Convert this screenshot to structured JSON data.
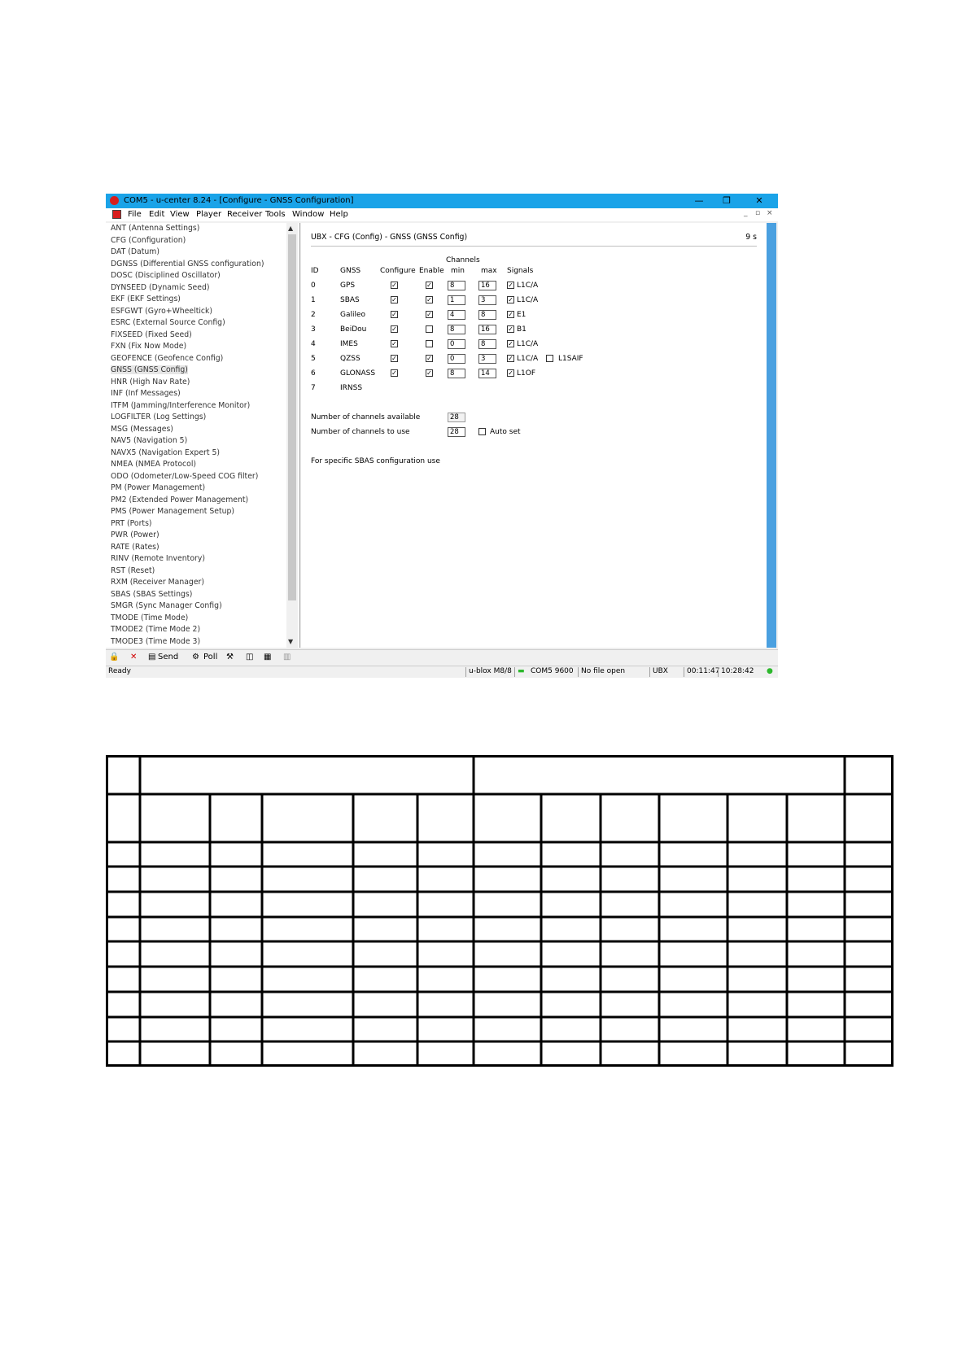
{
  "window": {
    "title": "COM5 - u-center 8.24 - [Configure - GNSS Configuration]",
    "controls": [
      "—",
      "❐",
      "✕"
    ],
    "mdi_controls": [
      "_",
      "▫",
      "×"
    ]
  },
  "menu": [
    "File",
    "Edit",
    "View",
    "Player",
    "Receiver",
    "Tools",
    "Window",
    "Help"
  ],
  "sidebar": {
    "items": [
      "ANT (Antenna Settings)",
      "CFG (Configuration)",
      "DAT (Datum)",
      "DGNSS (Differential GNSS configuration)",
      "DOSC (Disciplined Oscillator)",
      "DYNSEED (Dynamic Seed)",
      "EKF (EKF Settings)",
      "ESFGWT (Gyro+Wheeltick)",
      "ESRC (External Source Config)",
      "FIXSEED (Fixed Seed)",
      "FXN (Fix Now Mode)",
      "GEOFENCE (Geofence Config)",
      "GNSS (GNSS Config)",
      "HNR (High Nav Rate)",
      "INF (Inf Messages)",
      "ITFM (Jamming/Interference Monitor)",
      "LOGFILTER (Log Settings)",
      "MSG (Messages)",
      "NAV5 (Navigation 5)",
      "NAVX5 (Navigation Expert 5)",
      "NMEA (NMEA Protocol)",
      "ODO (Odometer/Low-Speed COG filter)",
      "PM (Power Management)",
      "PM2 (Extended Power Management)",
      "PMS (Power Management Setup)",
      "PRT (Ports)",
      "PWR (Power)",
      "RATE (Rates)",
      "RINV (Remote Inventory)",
      "RST (Reset)",
      "RXM (Receiver Manager)",
      "SBAS (SBAS Settings)",
      "SMGR (Sync Manager Config)",
      "TMODE (Time Mode)",
      "TMODE2 (Time Mode 2)",
      "TMODE3 (Time Mode 3)"
    ],
    "selected": "GNSS (GNSS Config)"
  },
  "panel": {
    "header": "UBX - CFG (Config) - GNSS (GNSS Config)",
    "timer": "9 s",
    "columns": {
      "id": "ID",
      "gnss": "GNSS",
      "configure": "Configure",
      "enable": "Enable",
      "channels": "Channels",
      "min": "min",
      "max": "max",
      "signals": "Signals"
    },
    "rows": [
      {
        "id": "0",
        "gnss": "GPS",
        "configure": true,
        "enable": true,
        "min": "8",
        "max": "16",
        "signal": "L1C/A"
      },
      {
        "id": "1",
        "gnss": "SBAS",
        "configure": true,
        "enable": true,
        "min": "1",
        "max": "3",
        "signal": "L1C/A"
      },
      {
        "id": "2",
        "gnss": "Galileo",
        "configure": true,
        "enable": true,
        "min": "4",
        "max": "8",
        "signal": "E1"
      },
      {
        "id": "3",
        "gnss": "BeiDou",
        "configure": true,
        "enable": false,
        "min": "8",
        "max": "16",
        "signal": "B1"
      },
      {
        "id": "4",
        "gnss": "IMES",
        "configure": true,
        "enable": false,
        "min": "0",
        "max": "8",
        "signal": "L1C/A"
      },
      {
        "id": "5",
        "gnss": "QZSS",
        "configure": true,
        "enable": true,
        "min": "0",
        "max": "3",
        "signal": "L1C/A",
        "extra_signal": "L1SAIF"
      },
      {
        "id": "6",
        "gnss": "GLONASS",
        "configure": true,
        "enable": true,
        "min": "8",
        "max": "14",
        "signal": "L1OF"
      },
      {
        "id": "7",
        "gnss": "IRNSS"
      }
    ],
    "channels_available_label": "Number of channels available",
    "channels_available": "28",
    "channels_to_use_label": "Number of channels to use",
    "channels_to_use": "28",
    "auto_set_label": "Auto set",
    "sbas_note": "For specific SBAS configuration use"
  },
  "toolbar": {
    "send": "Send",
    "poll": "Poll"
  },
  "status": {
    "ready": "Ready",
    "receiver": "u-blox M8/8",
    "port": "COM5 9600",
    "file": "No file open",
    "protocol": "UBX",
    "elapsed": "00:11:47",
    "clock": "10:28:42"
  },
  "colors": {
    "titlebar": "#1aa3e8",
    "scrollbar_accent": "#4aa0e0",
    "status_led": "#2db82d"
  }
}
